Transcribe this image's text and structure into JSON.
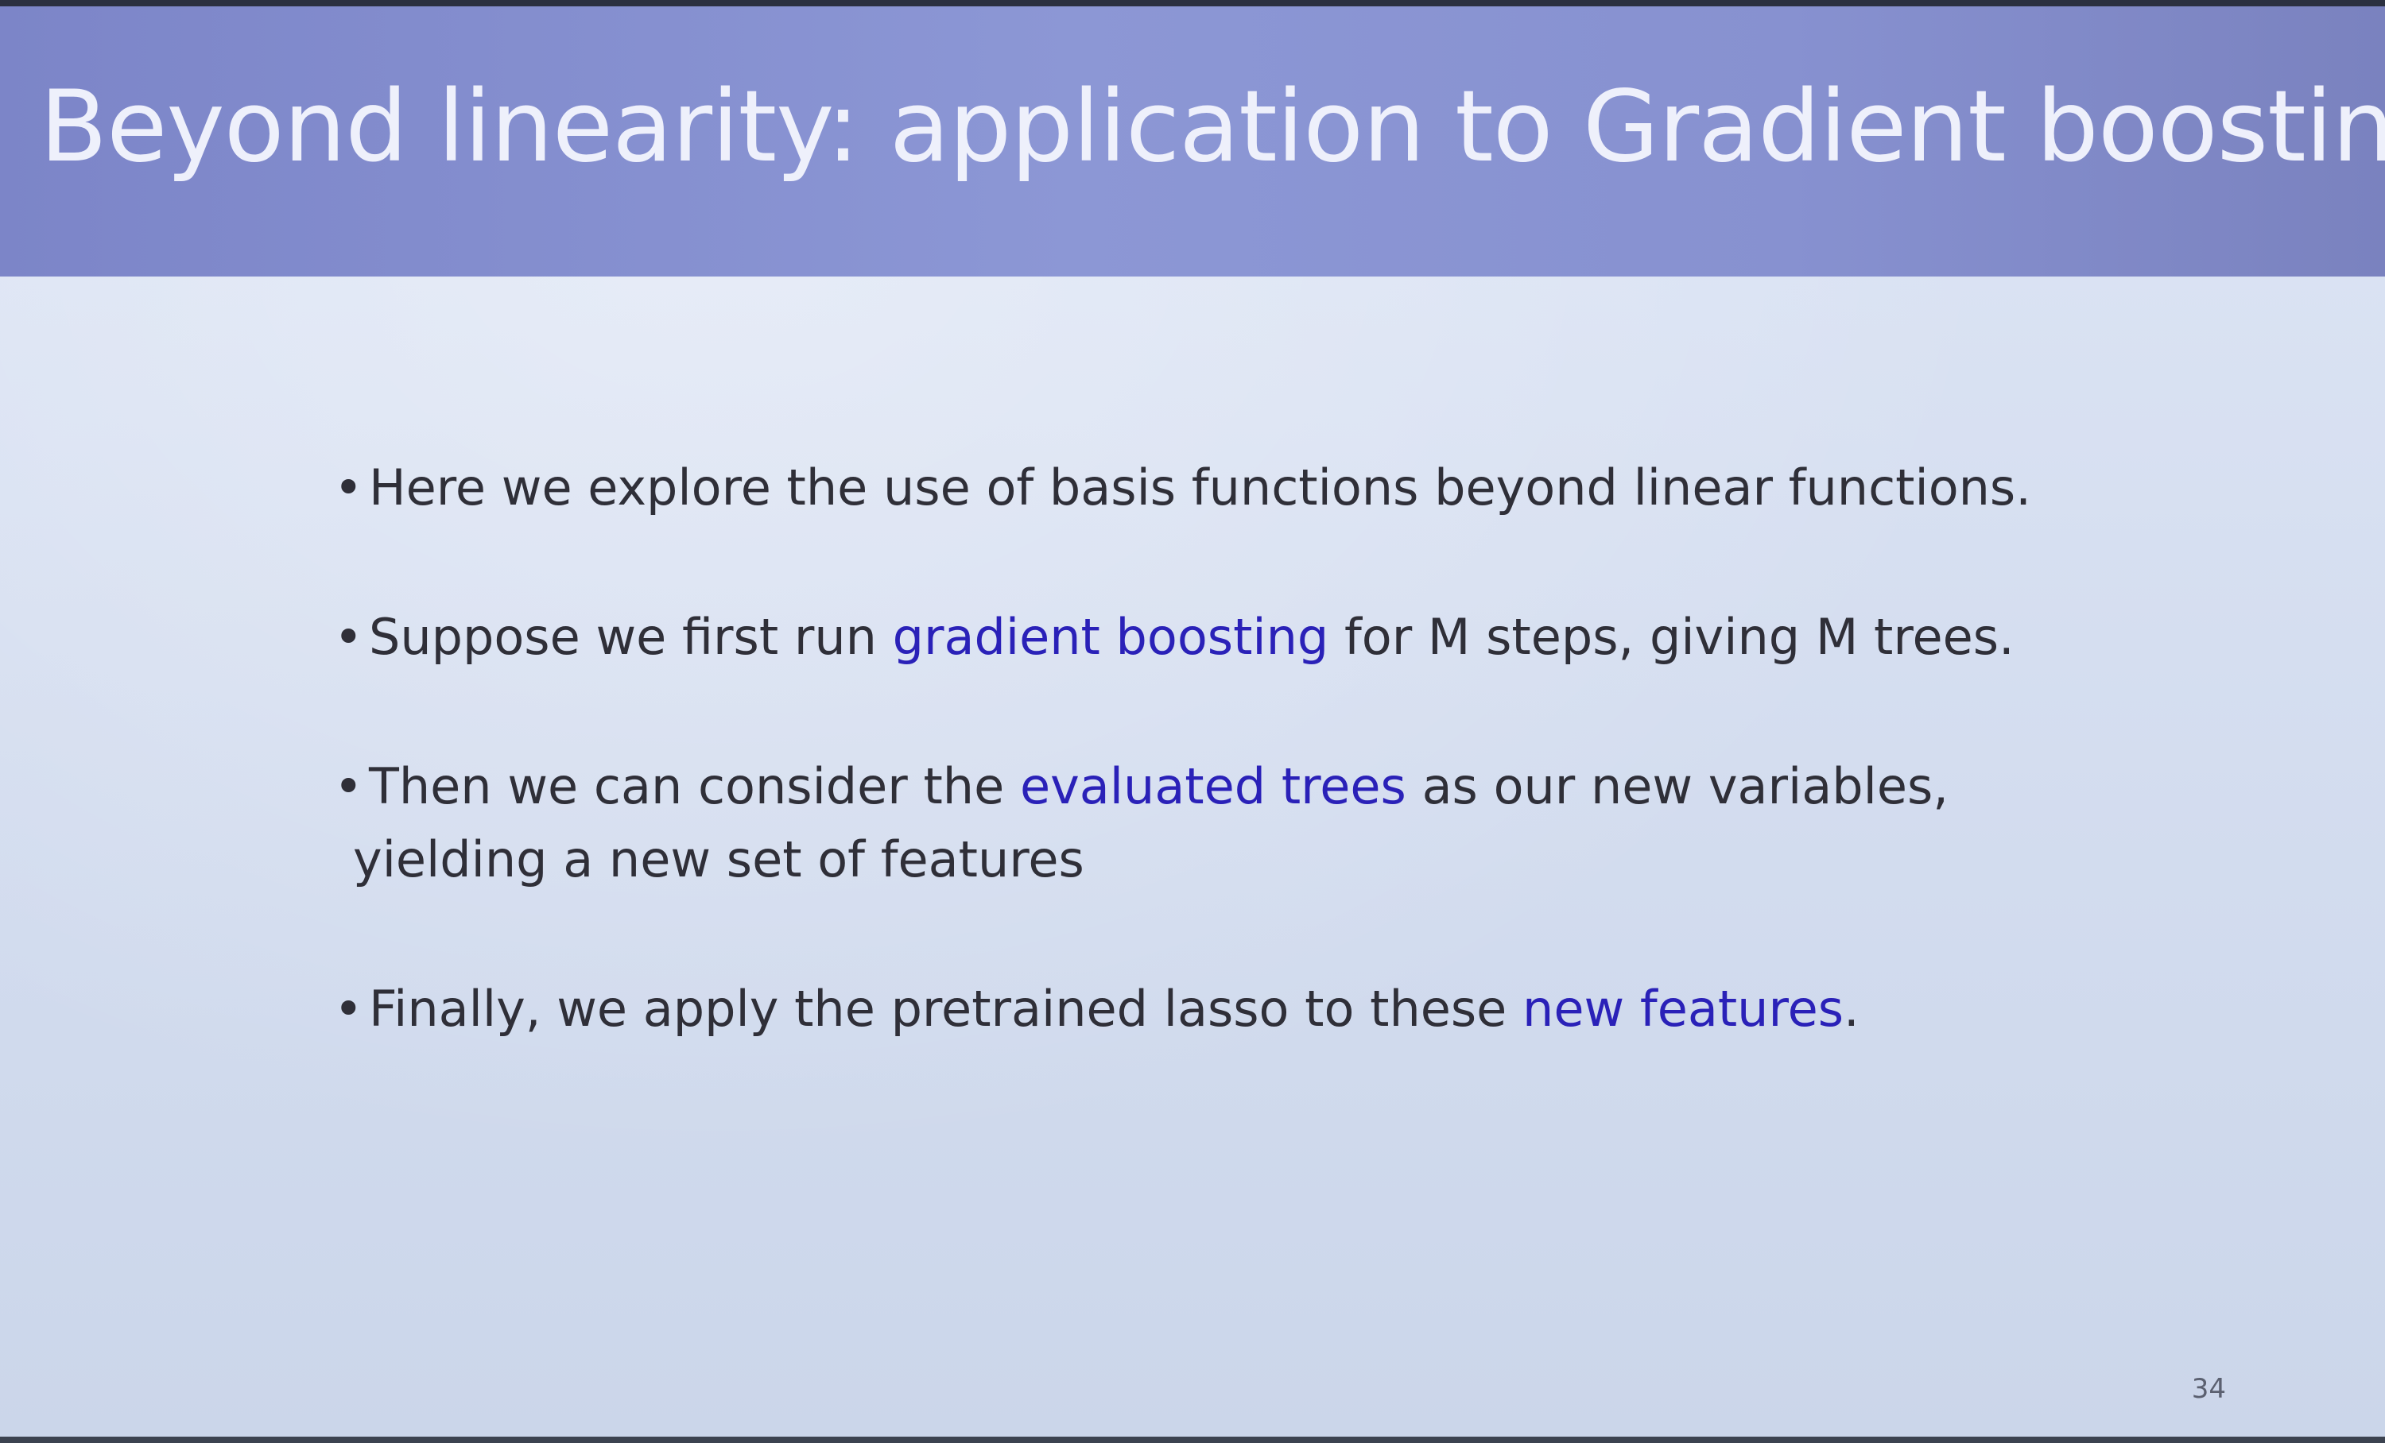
{
  "slide": {
    "title": "Beyond linearity: application to Gradient boosting",
    "page_number": "34",
    "bullets": [
      {
        "before": "Here we explore the use of basis functions beyond  linear functions.",
        "highlight": "",
        "after": ""
      },
      {
        "before": "Suppose we first run ",
        "highlight": "gradient boosting",
        "after": " for M steps, giving M trees."
      },
      {
        "before": "Then we can consider the ",
        "highlight": "evaluated trees",
        "after": " as our new variables,",
        "continuation": "yielding a new set of features"
      },
      {
        "before": "Finally, we  apply the pretrained lasso to these ",
        "highlight": "new features",
        "after": "."
      }
    ],
    "colors": {
      "title_bar": "#8791d0",
      "title_text": "#eef0fb",
      "body_text": "#2f2f38",
      "highlight_text": "#2a21b8",
      "background": "#d5def0"
    }
  }
}
